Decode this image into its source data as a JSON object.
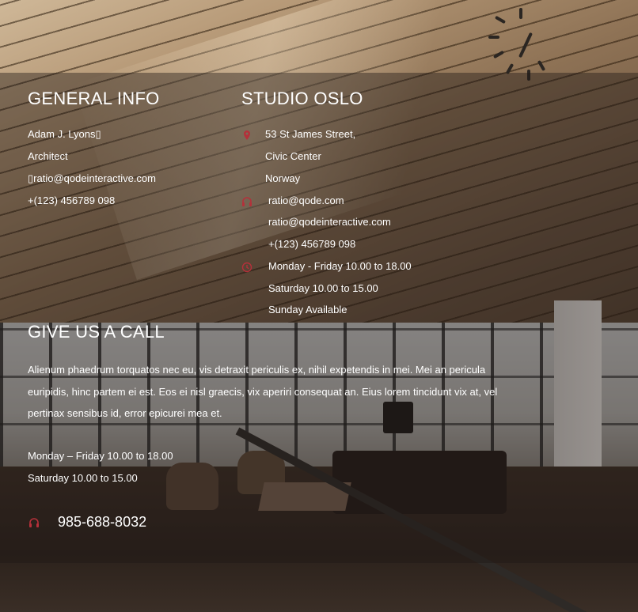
{
  "general_info": {
    "heading": "GENERAL INFO",
    "name": "Adam J. Lyons▯",
    "role": "Architect",
    "email": "▯ratio@qodeinteractive.com",
    "phone": "+(123) 456789 098"
  },
  "studio": {
    "heading": "STUDIO OSLO",
    "address": [
      "53 St James Street,",
      "Civic Center",
      "Norway"
    ],
    "contacts": [
      "ratio@qode.com",
      "ratio@qodeinteractive.com",
      "+(123) 456789 098"
    ],
    "hours": [
      "Monday - Friday 10.00 to 18.00",
      "Saturday 10.00 to 15.00",
      "Sunday Available"
    ]
  },
  "call": {
    "heading": "GIVE US A CALL",
    "paragraph": "Alienum phaedrum torquatos nec eu, vis detraxit periculis ex, nihil expetendis in mei. Mei an pericula euripidis, hinc partem ei est. Eos ei nisl graecis, vix aperiri consequat an. Eius lorem tincidunt vix at, vel pertinax sensibus id, error epicurei mea et.",
    "hours_weekday": "Monday – Friday 10.00 to 18.00",
    "hours_saturday": "Saturday 10.00 to 15.00",
    "phone": "985-688-8032"
  },
  "icons": {
    "location": "map-pin-icon",
    "contact": "headphones-icon",
    "hours": "clock-icon",
    "phone": "headphones-icon"
  },
  "colors": {
    "accent": "#b5303a",
    "text": "#ffffff"
  }
}
